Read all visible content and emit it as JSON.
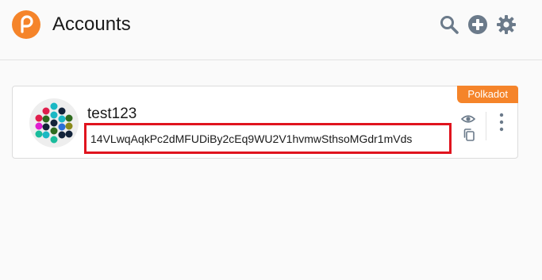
{
  "header": {
    "title": "Accounts",
    "logo_icon": "polkadot-logo",
    "actions": [
      "search-icon",
      "add-icon",
      "settings-icon"
    ],
    "brand_color": "#f5842a",
    "icon_color": "#6b7a8a"
  },
  "account": {
    "name": "test123",
    "address": "14VLwqAqkPc2dMFUDiBy2cEq9WU2V1hvmwSthsoMGdr1mVds",
    "network": "Polkadot",
    "highlight_color": "#e0141e"
  }
}
